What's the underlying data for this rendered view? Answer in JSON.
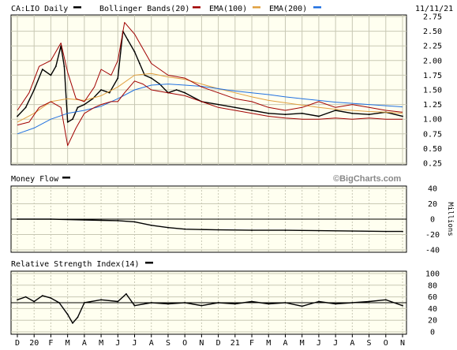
{
  "header": {
    "symbol": "CA:LIO Daily",
    "legend_bb": "Bollinger Bands(20)",
    "legend_ema100": "EMA(100)",
    "legend_ema200": "EMA(200)",
    "date": "11/11/21"
  },
  "watermark": "©BigCharts.com",
  "colors": {
    "background": "#ffffff",
    "panel_bg": "#fffff0",
    "price": "#000000",
    "bollinger": "#a00000",
    "ema100": "#e0a040",
    "ema200": "#2070e0",
    "grid": "#c8c8b4"
  },
  "x_axis": {
    "labels": [
      "D",
      "20",
      "F",
      "M",
      "A",
      "M",
      "J",
      "J",
      "A",
      "S",
      "O",
      "N",
      "D",
      "21",
      "F",
      "M",
      "A",
      "M",
      "J",
      "J",
      "A",
      "S",
      "O",
      "N"
    ]
  },
  "chart_data": [
    {
      "type": "line",
      "panel": "price",
      "title": "CA:LIO Daily",
      "yticks": [
        "2.75",
        "2.50",
        "2.25",
        "2.00",
        "1.75",
        "1.50",
        "1.25",
        "1.00",
        "0.75",
        "0.50",
        "0.25"
      ],
      "ylim": [
        0.25,
        2.75
      ],
      "grid": true,
      "series": [
        {
          "name": "CA:LIO Daily",
          "x": [
            0,
            0.5,
            1,
            1.5,
            2,
            2.3,
            2.6,
            2.8,
            3,
            3.3,
            3.6,
            4,
            4.5,
            5,
            5.5,
            6,
            6.3,
            6.6,
            7,
            7.3,
            7.6,
            8,
            8.5,
            9,
            9.5,
            10,
            11,
            12,
            13,
            14,
            15,
            16,
            17,
            18,
            19,
            20,
            21,
            22,
            23
          ],
          "values": [
            1.05,
            1.2,
            1.5,
            1.85,
            1.75,
            1.9,
            2.25,
            1.9,
            0.95,
            1.0,
            1.2,
            1.25,
            1.35,
            1.5,
            1.45,
            1.7,
            2.5,
            2.35,
            2.15,
            1.95,
            1.75,
            1.7,
            1.6,
            1.45,
            1.5,
            1.45,
            1.3,
            1.25,
            1.2,
            1.15,
            1.1,
            1.08,
            1.1,
            1.05,
            1.15,
            1.1,
            1.08,
            1.12,
            1.05
          ]
        },
        {
          "name": "EMA(100)",
          "x": [
            0,
            1,
            2,
            3,
            4,
            5,
            6,
            7,
            8,
            9,
            10,
            11,
            12,
            13,
            14,
            15,
            16,
            17,
            18,
            19,
            20,
            21,
            22,
            23
          ],
          "values": [
            0.95,
            1.1,
            1.3,
            1.35,
            1.32,
            1.4,
            1.55,
            1.75,
            1.78,
            1.72,
            1.68,
            1.6,
            1.52,
            1.45,
            1.38,
            1.32,
            1.28,
            1.24,
            1.2,
            1.17,
            1.15,
            1.13,
            1.12,
            1.1
          ]
        },
        {
          "name": "EMA(200)",
          "x": [
            0,
            1,
            2,
            3,
            4,
            5,
            6,
            7,
            8,
            9,
            10,
            11,
            12,
            13,
            14,
            15,
            16,
            17,
            18,
            19,
            20,
            21,
            22,
            23
          ],
          "values": [
            0.75,
            0.85,
            1.0,
            1.1,
            1.15,
            1.22,
            1.35,
            1.5,
            1.58,
            1.6,
            1.58,
            1.56,
            1.52,
            1.48,
            1.45,
            1.42,
            1.38,
            1.35,
            1.32,
            1.29,
            1.27,
            1.25,
            1.23,
            1.21
          ]
        },
        {
          "name": "Bollinger Bands(20) upper",
          "x": [
            0,
            0.7,
            1.3,
            2,
            2.6,
            3,
            3.5,
            4,
            4.6,
            5,
            5.6,
            6,
            6.4,
            7,
            7.5,
            8,
            9,
            10,
            11,
            12,
            13,
            14,
            15,
            16,
            17,
            18,
            19,
            20,
            21,
            22,
            23
          ],
          "values": [
            1.15,
            1.45,
            1.9,
            2.0,
            2.3,
            1.8,
            1.35,
            1.3,
            1.55,
            1.85,
            1.75,
            2.0,
            2.65,
            2.45,
            2.2,
            1.95,
            1.75,
            1.7,
            1.55,
            1.45,
            1.35,
            1.3,
            1.2,
            1.15,
            1.2,
            1.3,
            1.2,
            1.25,
            1.2,
            1.15,
            1.12
          ]
        },
        {
          "name": "Bollinger Bands(20) lower",
          "x": [
            0,
            0.7,
            1.3,
            2,
            2.6,
            3,
            3.5,
            4,
            4.6,
            5,
            5.6,
            6,
            6.4,
            7,
            7.5,
            8,
            9,
            10,
            11,
            12,
            13,
            14,
            15,
            16,
            17,
            18,
            19,
            20,
            21,
            22,
            23
          ],
          "values": [
            0.9,
            0.95,
            1.2,
            1.3,
            1.2,
            0.55,
            0.85,
            1.1,
            1.2,
            1.25,
            1.3,
            1.3,
            1.45,
            1.65,
            1.6,
            1.5,
            1.45,
            1.4,
            1.3,
            1.2,
            1.15,
            1.1,
            1.05,
            1.02,
            1.0,
            1.0,
            1.02,
            1.0,
            1.02,
            1.0,
            1.0
          ]
        }
      ]
    },
    {
      "type": "line",
      "panel": "money_flow",
      "title": "Money Flow",
      "ylabel": "Millions",
      "yticks": [
        "40",
        "20",
        "0",
        "-20",
        "-40"
      ],
      "ylim": [
        -40,
        40
      ],
      "series": [
        {
          "name": "Money Flow",
          "x": [
            0,
            2,
            3,
            4,
            5,
            6,
            7,
            8,
            9,
            10,
            12,
            14,
            16,
            18,
            20,
            22,
            23
          ],
          "values": [
            0,
            0,
            -0.5,
            -1,
            -1.5,
            -2,
            -3.5,
            -8,
            -11,
            -13,
            -14,
            -14.5,
            -14.5,
            -15,
            -15.5,
            -16,
            -16
          ]
        }
      ]
    },
    {
      "type": "line",
      "panel": "rsi",
      "title": "Relative Strength Index(14)",
      "yticks": [
        "100",
        "80",
        "60",
        "40",
        "20",
        "0"
      ],
      "ylim": [
        0,
        100
      ],
      "series": [
        {
          "name": "Relative Strength Index(14)",
          "x": [
            0,
            0.5,
            1,
            1.5,
            2,
            2.5,
            3,
            3.3,
            3.6,
            4,
            5,
            6,
            6.5,
            7,
            8,
            9,
            10,
            11,
            12,
            13,
            14,
            15,
            16,
            17,
            18,
            19,
            20,
            21,
            22,
            23
          ],
          "values": [
            55,
            60,
            52,
            62,
            58,
            50,
            30,
            15,
            25,
            50,
            55,
            52,
            65,
            45,
            50,
            48,
            50,
            45,
            50,
            48,
            52,
            48,
            50,
            44,
            52,
            48,
            50,
            52,
            55,
            45
          ]
        }
      ]
    }
  ]
}
